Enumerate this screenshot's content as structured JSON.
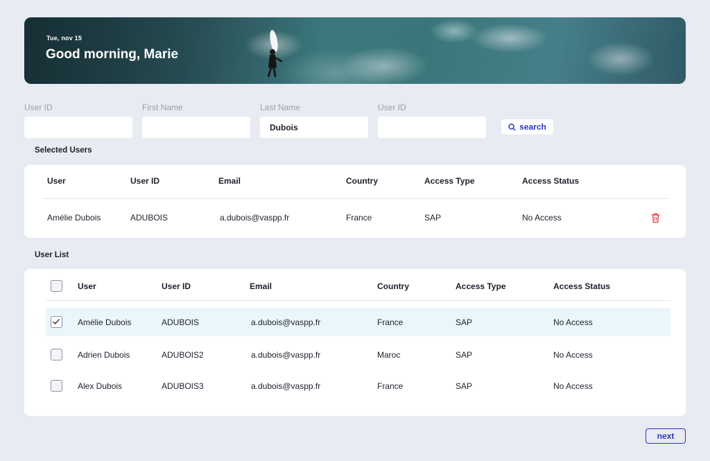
{
  "header": {
    "date": "Tue, nov 15",
    "greeting": "Good morning, Marie"
  },
  "filters": [
    {
      "label": "User ID",
      "value": ""
    },
    {
      "label": "First Name",
      "value": ""
    },
    {
      "label": "Last Name",
      "value": "Dubois"
    },
    {
      "label": "User ID",
      "value": ""
    }
  ],
  "search_label": "search",
  "selected_users": {
    "title": "Selected Users",
    "columns": [
      "User",
      "User ID",
      "Email",
      "Country",
      "Access Type",
      "Access Status"
    ],
    "rows": [
      [
        "Amélie Dubois",
        "ADUBOIS",
        "a.dubois@vaspp.fr",
        "France",
        "SAP",
        "No Access"
      ]
    ]
  },
  "user_list": {
    "title": "User List",
    "columns": [
      "User",
      "User ID",
      "Email",
      "Country",
      "Access Type",
      "Access Status"
    ],
    "rows": [
      {
        "checked": true,
        "cells": [
          "Amélie Dubois",
          "ADUBOIS",
          "a.dubois@vaspp.fr",
          "France",
          "SAP",
          "No Access"
        ]
      },
      {
        "checked": false,
        "cells": [
          "Adrien Dubois",
          "ADUBOIS2",
          "a.dubois@vaspp.fr",
          "Maroc",
          "SAP",
          "No Access"
        ]
      },
      {
        "checked": false,
        "cells": [
          "Alex Dubois",
          "ADUBOIS3",
          "a.dubois@vaspp.fr",
          "France",
          "SAP",
          "No Access"
        ]
      }
    ]
  },
  "next_label": "next",
  "colors": {
    "accent": "#2b34c9",
    "background": "#e8ebf1",
    "highlight_row": "#eaf6fb",
    "delete": "#e0343a"
  }
}
